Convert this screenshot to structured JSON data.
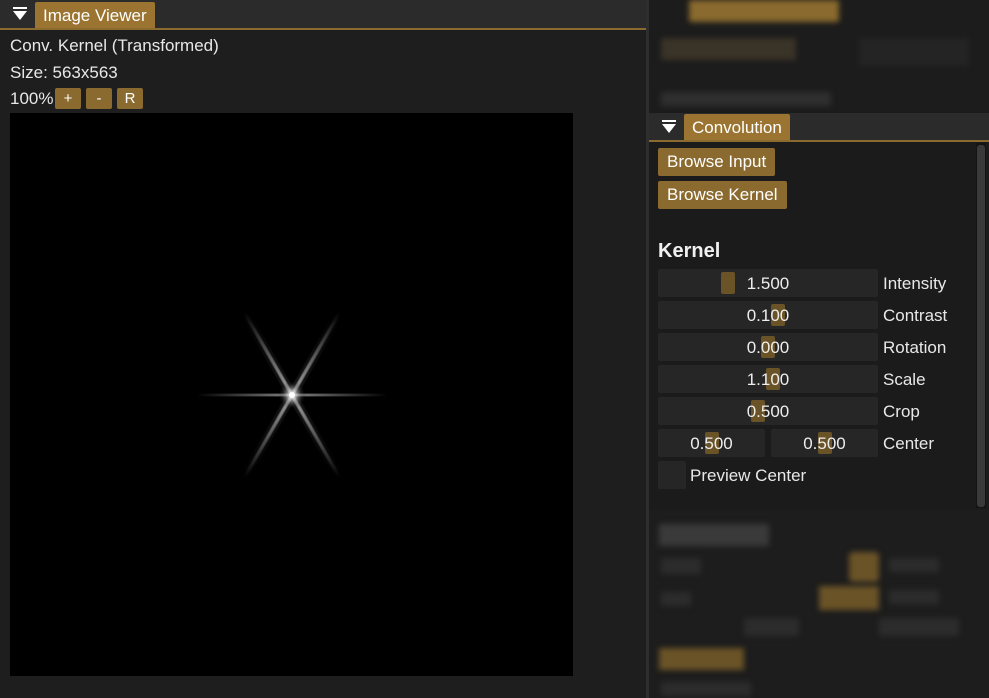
{
  "image_viewer": {
    "tab_label": "Image Viewer",
    "image_name": "Conv. Kernel (Transformed)",
    "size_text": "Size: 563x563",
    "zoom": "100%",
    "zoom_in_label": "+",
    "zoom_out_label": "-",
    "reset_label": "R"
  },
  "convolution": {
    "tab_label": "Convolution",
    "browse_input_label": "Browse Input",
    "browse_kernel_label": "Browse Kernel",
    "section_title": "Kernel",
    "params": {
      "intensity": {
        "label": "Intensity",
        "value": "1.500"
      },
      "contrast": {
        "label": "Contrast",
        "value": "0.100"
      },
      "rotation": {
        "label": "Rotation",
        "value": "0.000"
      },
      "scale": {
        "label": "Scale",
        "value": "1.100"
      },
      "crop": {
        "label": "Crop",
        "value": "0.500"
      },
      "center": {
        "label": "Center",
        "x": "0.500",
        "y": "0.500"
      }
    },
    "preview_center_label": "Preview Center"
  },
  "colors": {
    "accent": "#9a7430",
    "button": "#8a6a2e",
    "slider_grab": "#6a5327",
    "background": "#1b1b1b"
  }
}
